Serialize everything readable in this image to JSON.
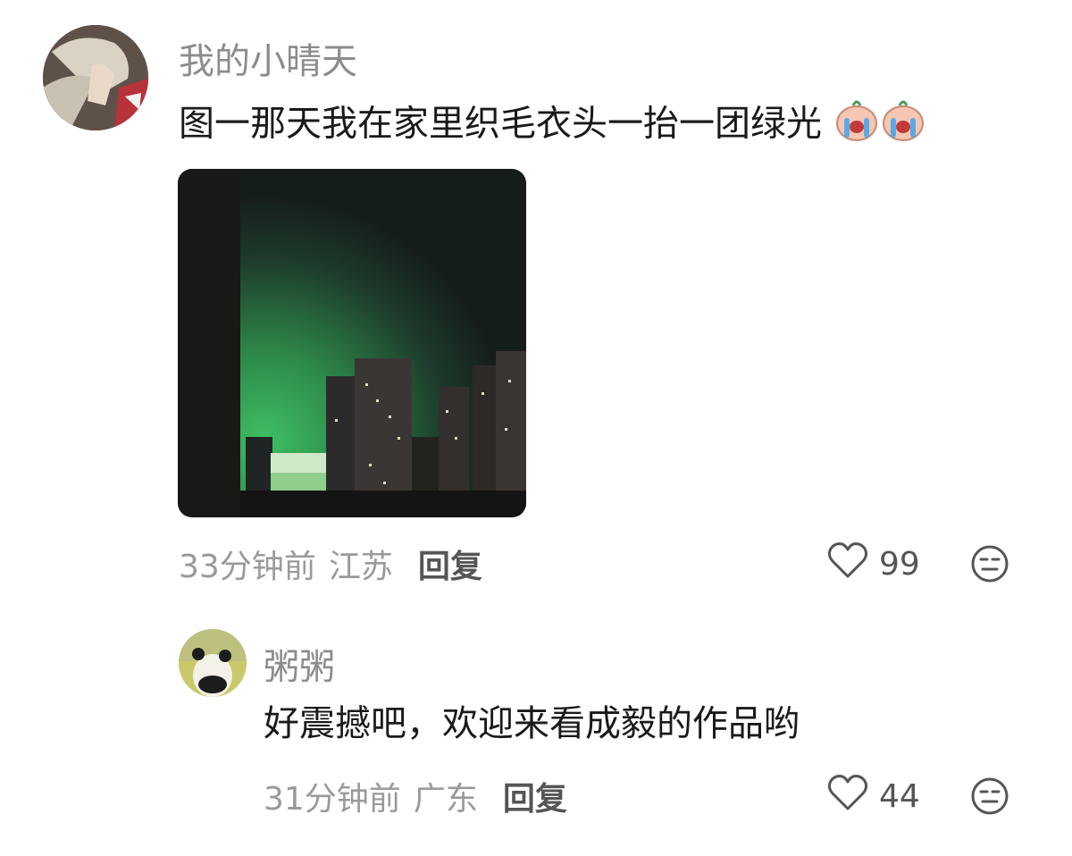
{
  "comments": [
    {
      "username": "我的小晴天",
      "text": "图一那天我在家里织毛衣头一抬一团绿光",
      "emojis": [
        "crying-face-emoji",
        "crying-face-emoji"
      ],
      "time": "33分钟前",
      "location": "江苏",
      "reply_label": "回复",
      "likes": "99"
    },
    {
      "username": "粥粥",
      "text": "好震撼吧，欢迎来看成毅的作品哟",
      "time": "31分钟前",
      "location": "广东",
      "reply_label": "回复",
      "likes": "44"
    }
  ],
  "colors": {
    "username": "#8c8c8c",
    "body_text": "#1a1a1a",
    "meta_text": "#9a9a9a",
    "icon": "#555555",
    "sky_green": "#2e8a4a"
  }
}
